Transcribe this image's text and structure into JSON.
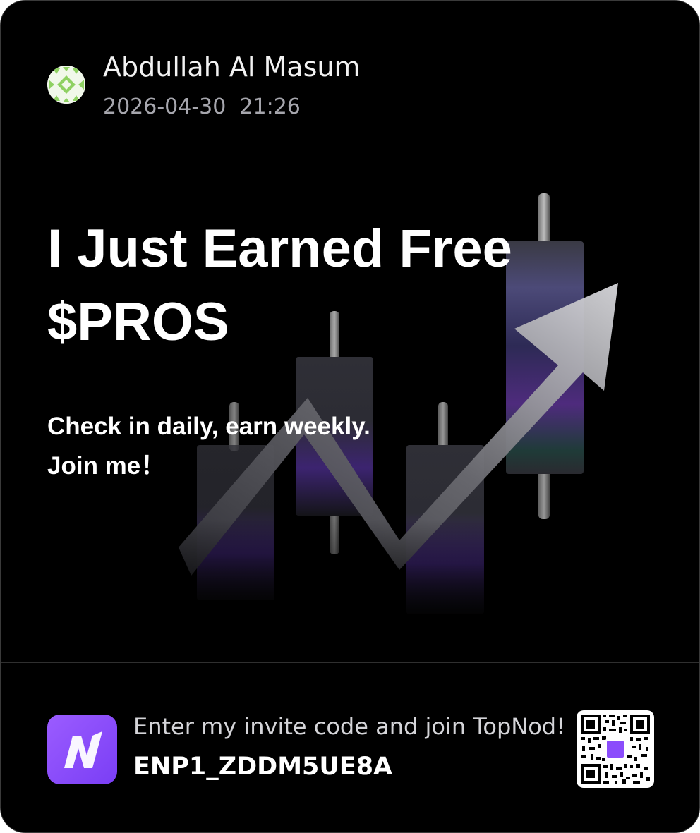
{
  "user": {
    "name": "Abdullah Al Masum",
    "datetime": "2026-04-30  21:26"
  },
  "headline": {
    "line1": "I Just Earned Free",
    "line2": "$PROS"
  },
  "subtext": {
    "line1": "Check in daily, earn weekly.",
    "line2": "Join me！"
  },
  "footer": {
    "invite_text": "Enter my invite code and join TopNod!",
    "invite_code": "ENP1_ZDDM5UE8A",
    "app_icon": "topnod-logo-icon",
    "qr_code": "qr-code-icon"
  },
  "colors": {
    "background": "#000000",
    "accent": "#8b4dfc",
    "muted_text": "#a6a6ad"
  }
}
